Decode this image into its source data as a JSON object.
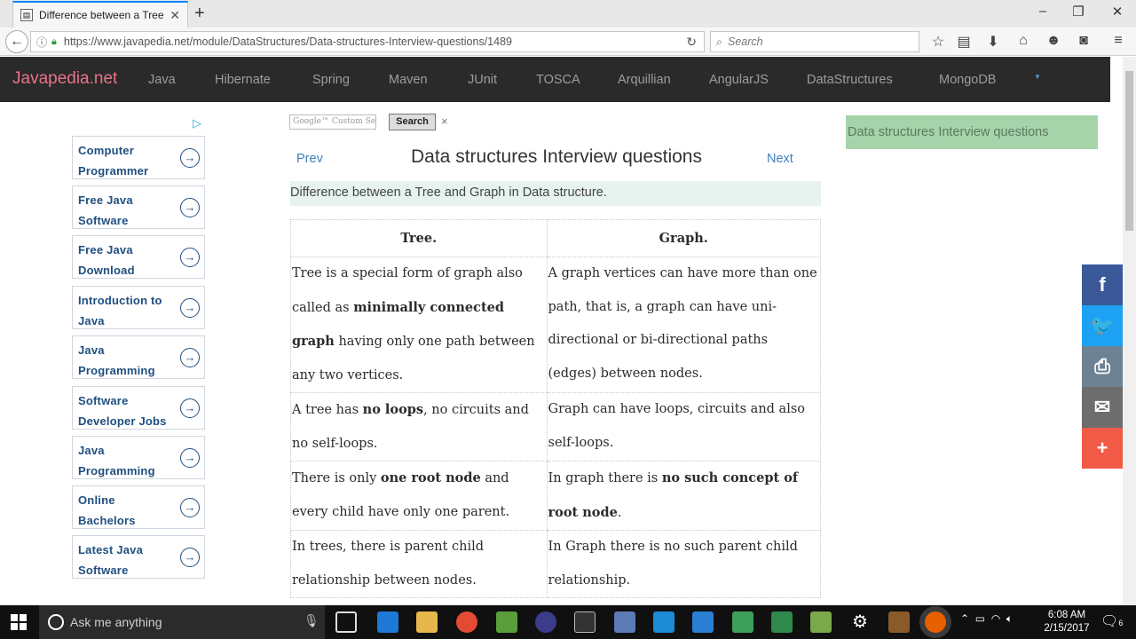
{
  "browser": {
    "tab_title": "Difference between a Tree...",
    "url": "https://www.javapedia.net/module/DataStructures/Data-structures-Interview-questions/1489",
    "search_placeholder": "Search",
    "newtab_label": "+"
  },
  "site": {
    "logo": "Javapedia.net",
    "nav": [
      "Java",
      "Hibernate",
      "Spring",
      "Maven",
      "JUnit",
      "TOSCA",
      "Arquillian",
      "AngularJS",
      "DataStructures",
      "MongoDB"
    ]
  },
  "ads": [
    "Computer Programmer",
    "Free Java Software",
    "Free Java Download",
    "Introduction to Java",
    "Java Programming",
    "Software Developer Jobs",
    "Java Programming",
    "Online Bachelors",
    "Latest Java Software"
  ],
  "search_widget": {
    "placeholder": "Google™ Custom Sea",
    "button": "Search",
    "clear": "×"
  },
  "main": {
    "prev": "Prev",
    "next": "Next",
    "title": "Data structures Interview questions",
    "subtitle": "Difference between a Tree and Graph in Data structure.",
    "table": {
      "headers": [
        "Tree.",
        "Graph."
      ],
      "rows": [
        {
          "tree": [
            {
              "t": "Tree is a special form of graph also called as "
            },
            {
              "b": "minimally connected graph"
            },
            {
              "t": " having only one path between any two vertices."
            }
          ],
          "graph": [
            {
              "t": "A graph vertices can have more than one path, that is, a graph can have uni-directional or bi-directional paths (edges) between nodes."
            }
          ]
        },
        {
          "tree": [
            {
              "t": "A tree has "
            },
            {
              "b": "no loops"
            },
            {
              "t": ", no circuits and no self-loops."
            }
          ],
          "graph": [
            {
              "t": "Graph can have loops, circuits and also self-loops."
            }
          ]
        },
        {
          "tree": [
            {
              "t": "There is only "
            },
            {
              "b": "one root node"
            },
            {
              "t": " and every child have only one parent."
            }
          ],
          "graph": [
            {
              "t": "In graph there is "
            },
            {
              "b": "no such concept of root node"
            },
            {
              "t": "."
            }
          ]
        },
        {
          "tree": [
            {
              "t": "In trees, there is parent child relationship between nodes."
            }
          ],
          "graph": [
            {
              "t": "In Graph there is no such parent child relationship."
            }
          ]
        }
      ]
    }
  },
  "sidebar_right": {
    "related": "Data structures Interview questions"
  },
  "share": [
    {
      "icon": "facebook-icon",
      "glyph": "f",
      "color": "#3b5998"
    },
    {
      "icon": "twitter-icon",
      "glyph": "🐦",
      "color": "#1da1f2"
    },
    {
      "icon": "print-icon",
      "glyph": "⎙",
      "color": "#6d8293"
    },
    {
      "icon": "email-icon",
      "glyph": "✉",
      "color": "#6d6d6d"
    },
    {
      "icon": "more-icon",
      "glyph": "+",
      "color": "#f05a47"
    }
  ],
  "taskbar": {
    "search_placeholder": "Ask me anything",
    "time": "6:08 AM",
    "date": "2/15/2017",
    "notification_count": "6"
  }
}
